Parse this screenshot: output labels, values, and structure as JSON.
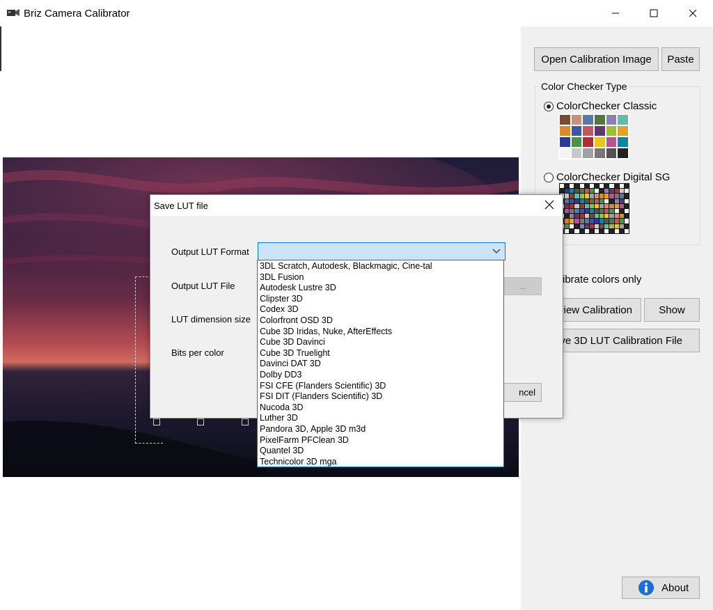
{
  "window": {
    "title": "Briz Camera Calibrator",
    "minimize_glyph": "—",
    "maximize_glyph": "☐",
    "close_glyph": "✕"
  },
  "right_panel": {
    "open_button": "Open Calibration Image",
    "paste_button": "Paste",
    "checker_group_title": "Color Checker Type",
    "classic_label": "ColorChecker Classic",
    "classic_checked": true,
    "digital_sg_label": "ColorChecker Digital SG",
    "digital_sg_checked": false,
    "calibrate_colors_text": "ibrate colors only",
    "view_calibration_button": "view Calibration",
    "show_button": "Show",
    "save_lut_button": "ve 3D LUT Calibration File",
    "about_button": "About",
    "classic_colors": [
      "#7a4a32",
      "#c8907c",
      "#5b7aa3",
      "#557640",
      "#8981b1",
      "#63bca6",
      "#d88a2a",
      "#4056a3",
      "#c25660",
      "#5a3b6c",
      "#a0bc3e",
      "#e0a230",
      "#2a3b94",
      "#4a9448",
      "#ad2f35",
      "#e8c521",
      "#b85393",
      "#0a85a6",
      "#f4f4f4",
      "#c8c8c8",
      "#a0a0a0",
      "#787878",
      "#525252",
      "#232323"
    ]
  },
  "dialog": {
    "title": "Save LUT file",
    "close_glyph": "✕",
    "output_format_label": "Output LUT Format",
    "output_format_value": "",
    "output_file_label": "Output LUT File",
    "browse_label": "...",
    "dimension_label": "LUT dimension size",
    "bits_label": "Bits per color",
    "cancel_label": "ncel"
  },
  "dropdown": {
    "items": [
      "3DL Scratch, Autodesk, Blackmagic, Cine-tal",
      "3DL Fusion",
      "Autodesk Lustre 3D",
      "Clipster 3D",
      "Codex 3D",
      "Colorfront OSD 3D",
      "Cube 3D Iridas, Nuke, AfterEffects",
      "Cube 3D Davinci",
      "Cube 3D Truelight",
      "Davinci DAT 3D",
      "Dolby DD3",
      "FSI CFE (Flanders Scientific) 3D",
      "FSI DIT (Flanders Scientific) 3D",
      "Nucoda 3D",
      "Luther 3D",
      "Pandora 3D, Apple 3D m3d",
      "PixelFarm PFClean 3D",
      "Quantel 3D",
      "Technicolor 3D mga"
    ]
  },
  "colors": {
    "accent": "#0078d7",
    "combo_highlight": "#cce4f7",
    "panel_bg": "#f0f0f0",
    "about_icon": "#1e6fcf"
  }
}
